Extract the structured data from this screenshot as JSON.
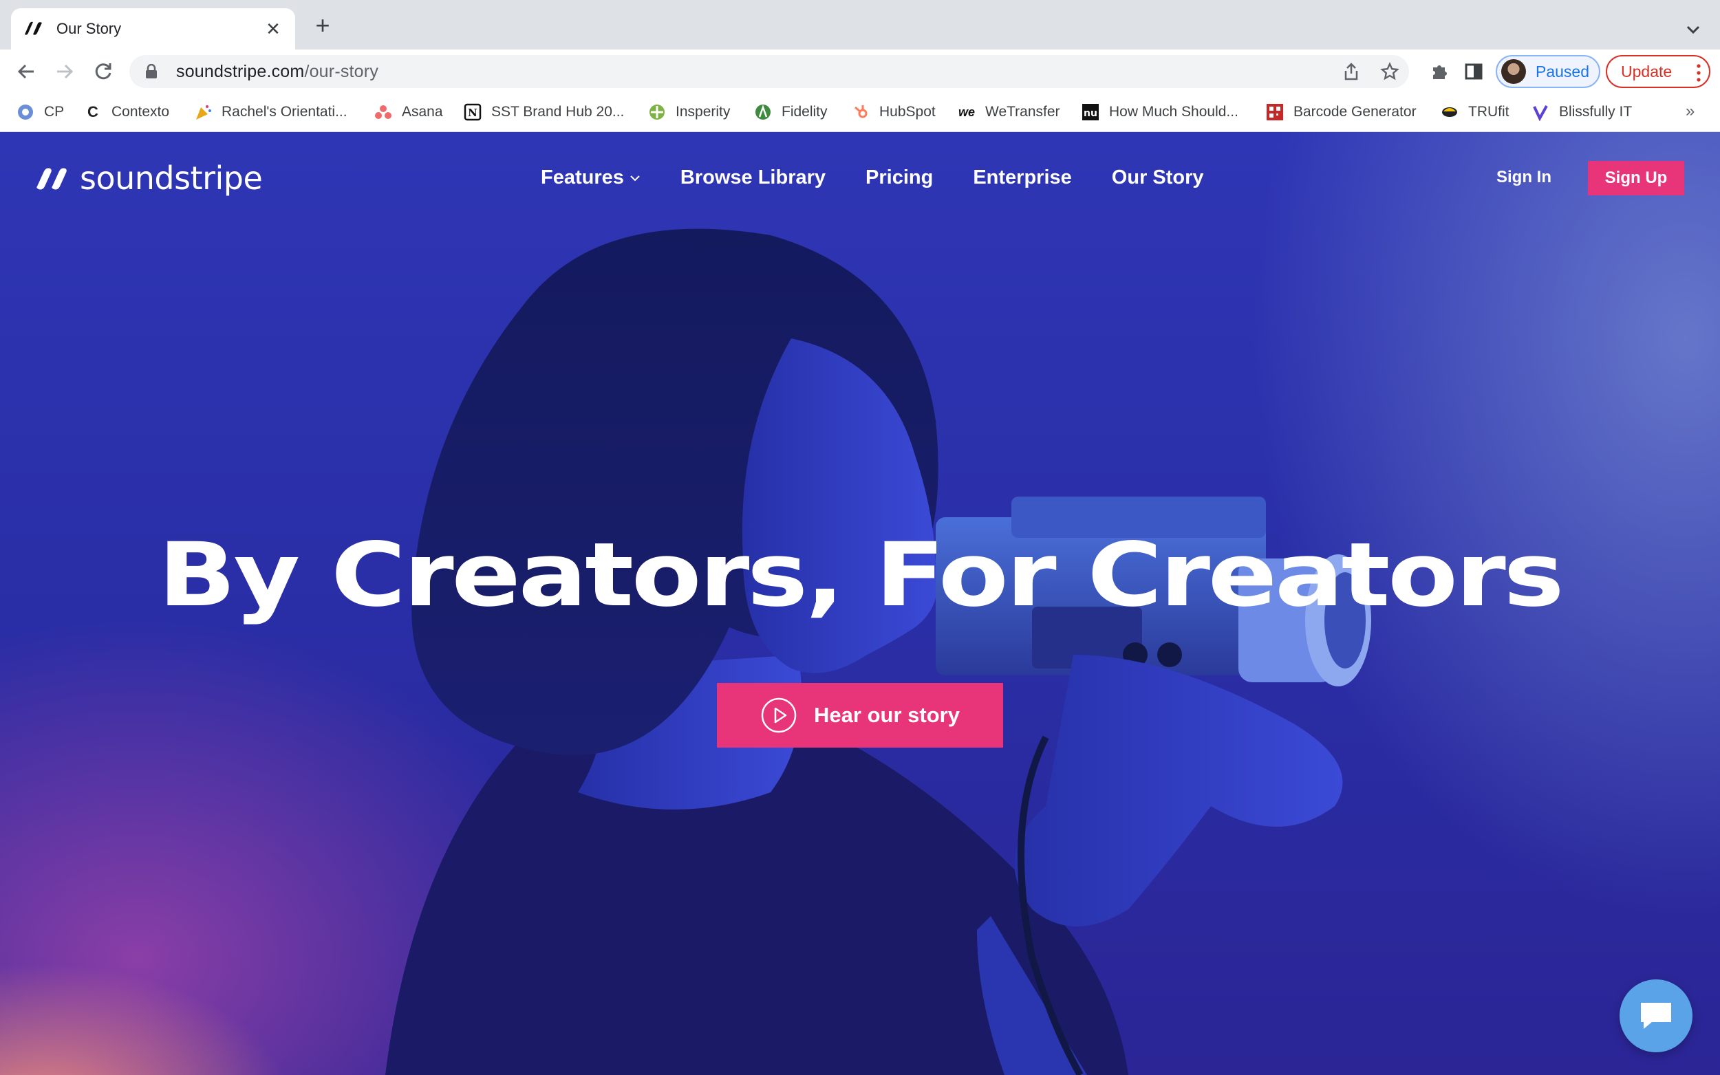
{
  "browser": {
    "tab": {
      "title": "Our Story",
      "close_glyph": "✕"
    },
    "new_tab_glyph": "+",
    "url": {
      "host": "soundstripe.com",
      "path": "/our-story"
    },
    "profile": {
      "label": "Paused"
    },
    "update": {
      "label": "Update"
    },
    "bookmarks": [
      {
        "label": "CP",
        "icon": "gear-flower-icon"
      },
      {
        "label": "Contexto",
        "icon": "c-letter-icon"
      },
      {
        "label": "Rachel's Orientati...",
        "icon": "party-icon"
      },
      {
        "label": "Asana",
        "icon": "asana-icon"
      },
      {
        "label": "SST Brand Hub 20...",
        "icon": "notion-icon"
      },
      {
        "label": "Insperity",
        "icon": "insperity-icon"
      },
      {
        "label": "Fidelity",
        "icon": "fidelity-icon"
      },
      {
        "label": "HubSpot",
        "icon": "hubspot-icon"
      },
      {
        "label": "WeTransfer",
        "icon": "wetransfer-icon"
      },
      {
        "label": "How Much Should...",
        "icon": "nu-icon"
      },
      {
        "label": "Barcode Generator",
        "icon": "barcode-icon"
      },
      {
        "label": "TRUfit",
        "icon": "trufit-icon"
      },
      {
        "label": "Blissfully IT",
        "icon": "blissfully-icon"
      }
    ],
    "bookmarks_more": "»"
  },
  "site": {
    "logo_text": "soundstripe",
    "nav": {
      "features": "Features",
      "browse": "Browse Library",
      "pricing": "Pricing",
      "enterprise": "Enterprise",
      "our_story": "Our Story"
    },
    "sign_in": "Sign In",
    "sign_up": "Sign Up",
    "hero": {
      "headline": "By Creators, For Creators",
      "cta": "Hear our story"
    }
  },
  "colors": {
    "accent_pink": "#e8357a",
    "hero_blue": "#2f36b5",
    "chat_blue": "#5aa3e8"
  }
}
